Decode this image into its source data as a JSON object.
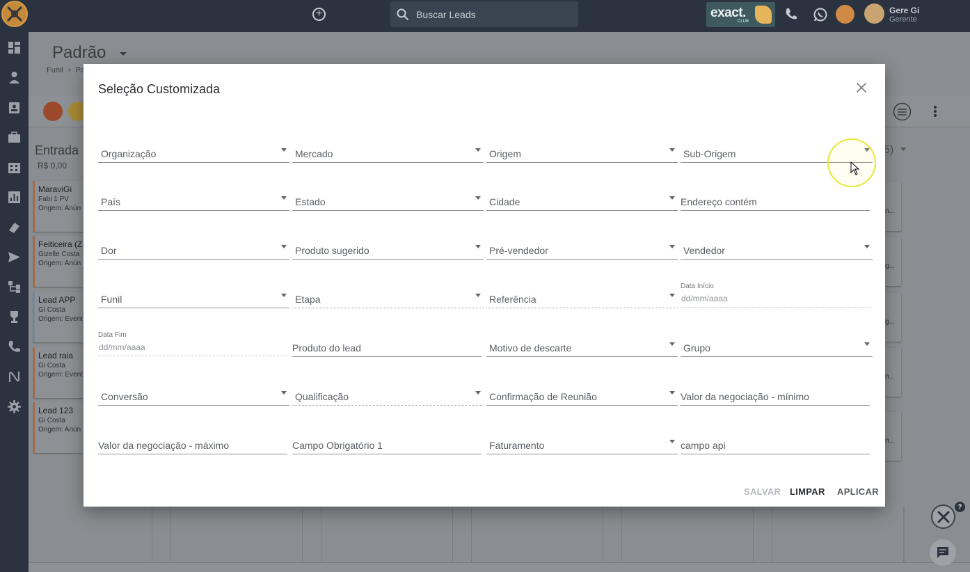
{
  "topbar": {
    "search_placeholder": "Buscar Leads",
    "brand_main": "exact.",
    "brand_sub": "CLUB",
    "user_name": "Gere Gi",
    "user_role": "Gerente"
  },
  "page": {
    "title": "Padrão",
    "breadcrumb_root": "Funil",
    "breadcrumb_current": "Pa"
  },
  "board": {
    "column_title": "Entrada",
    "column_value": "R$ 0,00",
    "right_count": "5)",
    "cards": [
      {
        "title": "MaraviGi",
        "line1": "Fabi 1 PV",
        "line2": "Origem: Anún"
      },
      {
        "title": "Feiticeira (Z",
        "line1": "Gizelle Costa",
        "line2": "Origem: Anún"
      },
      {
        "title": "Lead APP",
        "line1": "Gi Costa",
        "line2": "Origem: Event"
      },
      {
        "title": "Lead raia",
        "line1": "Gi Costa",
        "line2": "Origem: Event"
      },
      {
        "title": "Lead 123",
        "line1": "Gi Costa",
        "line2": "Origem: Anún"
      }
    ],
    "right_snippets": [
      "n...",
      "g...",
      "g...",
      "n...",
      "n..."
    ]
  },
  "modal": {
    "title": "Seleção Customizada",
    "fields": {
      "organizacao": "Organização",
      "mercado": "Mercado",
      "origem": "Origem",
      "sub_origem": "Sub-Origem",
      "pais": "País",
      "estado": "Estado",
      "cidade": "Cidade",
      "endereco": "Endereço contém",
      "dor": "Dor",
      "produto_sugerido": "Produto sugerido",
      "pre_vendedor": "Pré-vendedor",
      "vendedor": "Vendedor",
      "funil": "Funil",
      "etapa": "Etapa",
      "referencia": "Referência",
      "data_inicio_label": "Data Início",
      "data_inicio_placeholder": "dd/mm/aaaa",
      "data_fim_label": "Data Fim",
      "data_fim_placeholder": "dd/mm/aaaa",
      "produto_lead": "Produto do lead",
      "motivo_descarte": "Motivo de descarte",
      "grupo": "Grupo",
      "conversao": "Conversão",
      "qualificacao": "Qualificação",
      "confirmacao_reuniao": "Confirmação de Reunião",
      "valor_min": "Valor da negociação - mínimo",
      "valor_max": "Valor da negociação - máximo",
      "campo_obrigatorio": "Campo Obrigatório 1",
      "faturamento": "Faturamento",
      "campo_api": "campo api"
    },
    "buttons": {
      "save": "SALVAR",
      "clear": "LIMPAR",
      "apply": "APLICAR"
    }
  },
  "colors": {
    "topbar": "#2b3340",
    "overlay": "#8a8d91",
    "card_accent": "#a7673c",
    "cursor_highlight": "#e8e83a"
  }
}
